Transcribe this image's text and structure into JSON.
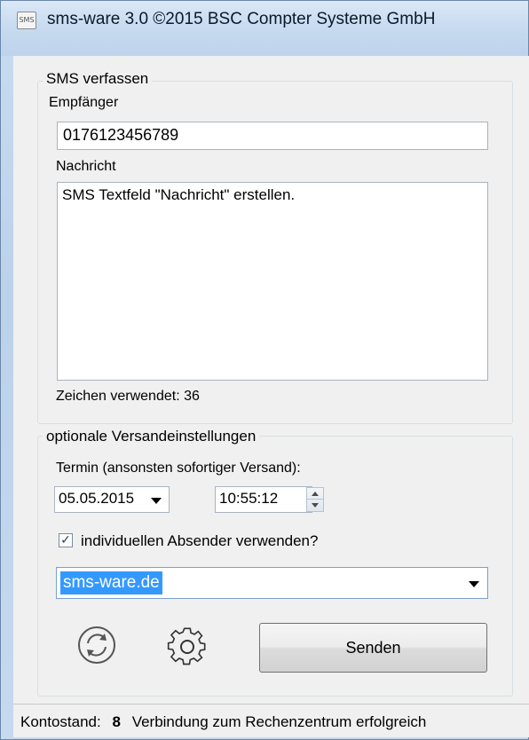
{
  "window": {
    "title": "sms-ware 3.0 ©2015 BSC Compter Systeme GmbH",
    "icon_text": "SMS"
  },
  "compose": {
    "group_title": "SMS verfassen",
    "recipient_label": "Empfänger",
    "recipient_value": "0176123456789",
    "message_label": "Nachricht",
    "message_value": "SMS Textfeld \"Nachricht\" erstellen.",
    "chars_used": "Zeichen verwendet: 36"
  },
  "options": {
    "group_title": "optionale Versandeinstellungen",
    "schedule_label": "Termin (ansonsten sofortiger Versand):",
    "date_value": "05.05.2015",
    "time_value": "10:55:12",
    "sender_checkbox_label": "individuellen Absender verwenden?",
    "sender_checked": true,
    "sender_value": "sms-ware.de"
  },
  "actions": {
    "refresh_icon": "refresh-icon",
    "settings_icon": "gear-icon",
    "send_label": "Senden"
  },
  "status": {
    "balance_label": "Kontostand:",
    "balance_value": "8",
    "connection_text": "Verbindung zum Rechenzentrum erfolgreich"
  }
}
